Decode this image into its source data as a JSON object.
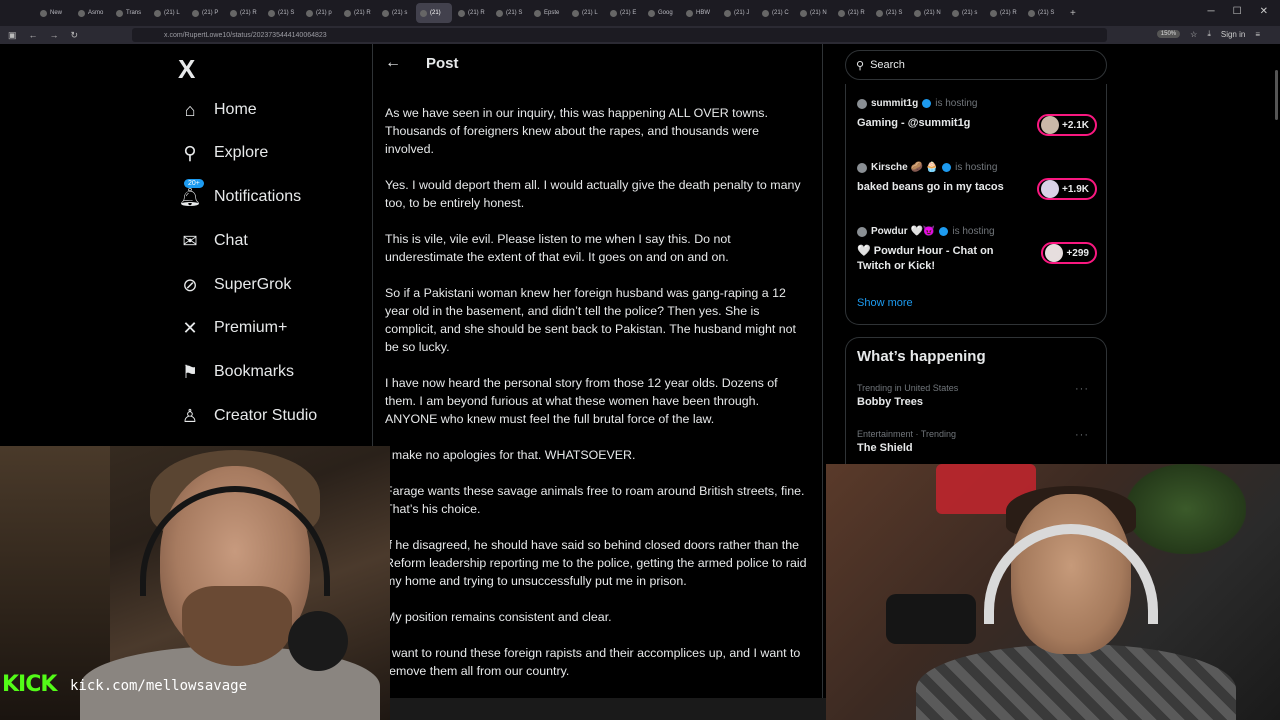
{
  "browser": {
    "tabs": [
      "New",
      "Asmo",
      "Trans",
      "(21) L",
      "(21) P",
      "(21) R",
      "(21) S",
      "(21) p",
      "(21) R",
      "(21) s",
      "(21)",
      "(21) R",
      "(21) S",
      "Epste",
      "(21) L",
      "(21) E",
      "Goog",
      "HBW",
      "(21) J",
      "(21) C",
      "(21) N",
      "(21) R",
      "(21) S",
      "(21) N",
      "(21) s",
      "(21) R",
      "(21) S"
    ],
    "active_tab_index": 10,
    "url": "x.com/RupertLowe10/status/2023735444140064823",
    "zoom": "150%",
    "account_label": "Sign in"
  },
  "sidebar": {
    "logo": "X",
    "notif_badge": "20+",
    "items": [
      {
        "label": "Home",
        "icon": "home-icon"
      },
      {
        "label": "Explore",
        "icon": "search-icon"
      },
      {
        "label": "Notifications",
        "icon": "bell-icon"
      },
      {
        "label": "Chat",
        "icon": "mail-icon"
      },
      {
        "label": "SuperGrok",
        "icon": "grok-icon"
      },
      {
        "label": "Premium+",
        "icon": "x-icon"
      },
      {
        "label": "Bookmarks",
        "icon": "bookmark-icon"
      },
      {
        "label": "Creator Studio",
        "icon": "creator-icon"
      }
    ]
  },
  "post": {
    "title": "Post",
    "paragraphs": [
      "As we have seen in our inquiry, this was happening ALL OVER towns. Thousands of foreigners knew about the rapes, and thousands were involved.",
      "Yes. I would deport them all. I would actually give the death penalty to many too, to be entirely honest.",
      "This is vile, vile evil. Please listen to me when I say this. Do not underestimate the extent of that evil. It goes on and on and on.",
      "So if a Pakistani woman knew her foreign husband was gang-raping a 12 year old in the basement, and didn’t tell the police? Then yes. She is complicit, and she should be sent back to Pakistan. The husband might not be so lucky.",
      "I have now heard the personal story from those 12 year olds. Dozens of them. I am beyond furious at what these women have been through. ANYONE who knew must feel the full brutal force of the law.",
      "I make no apologies for that. WHATSOEVER.",
      "Farage wants these savage animals free to roam around British streets, fine. That’s his choice.",
      "If he disagreed, he should have said so behind closed doors rather than the Reform leadership reporting me to the police, getting the armed police to raid my home and trying to unsuccessfully put me in prison.",
      "My position remains consistent and clear.",
      "I want to round these foreign rapists and their accomplices up, and I want to remove them all from our country."
    ]
  },
  "right": {
    "search_placeholder": "Search",
    "live": [
      {
        "host": "summit1g",
        "status": "is hosting",
        "title": "Gaming - @summit1g",
        "count": "+2.1K"
      },
      {
        "host": "Kirsche 🥔 🧁",
        "status": "is hosting",
        "title": "baked beans go in my tacos",
        "count": "+1.9K"
      },
      {
        "host": "Powdur 🤍😈",
        "status": "is hosting",
        "title": "🤍 Powdur Hour - Chat on Twitch or  Kick!",
        "count": "+299"
      }
    ],
    "show_more": "Show more",
    "happening_title": "What’s happening",
    "trends": [
      {
        "meta": "Trending in United States",
        "name": "Bobby Trees"
      },
      {
        "meta": "Entertainment · Trending",
        "name": "The Shield"
      }
    ]
  },
  "overlay": {
    "kick_logo": "KICK",
    "kick_url": "kick.com/mellowsavage"
  },
  "colors": {
    "background": "#000000",
    "accent": "#1d9bf0",
    "live_ring": "#f91880",
    "kick_green": "#53fc18"
  }
}
